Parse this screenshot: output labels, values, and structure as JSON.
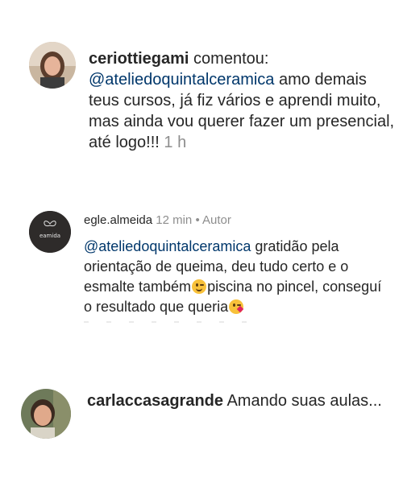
{
  "comments": [
    {
      "username": "ceriottiegami",
      "action": "comentou:",
      "mention": "@ateliedoquintalceramica",
      "text": "amo demais teus cursos, já fiz vários e aprendi muito, mas ainda vou querer fazer um presencial, até logo!!!",
      "time": "1 h"
    },
    {
      "username": "egle.almeida",
      "time": "12 min",
      "separator": "•",
      "badge": "Autor",
      "mention": "@ateliedoquintalceramica",
      "text_part1": "gratidão pela orientação de queima, deu tudo certo e o esmalte também",
      "text_part2": "piscina no pincel, conseguí o resultado que queria",
      "avatar_logo_text": "eamida"
    },
    {
      "username": "carlaccasagrande",
      "text": "Amando suas aulas..."
    }
  ],
  "colors": {
    "mention": "#00376b",
    "muted": "#8e8e8e",
    "text": "#262626"
  }
}
